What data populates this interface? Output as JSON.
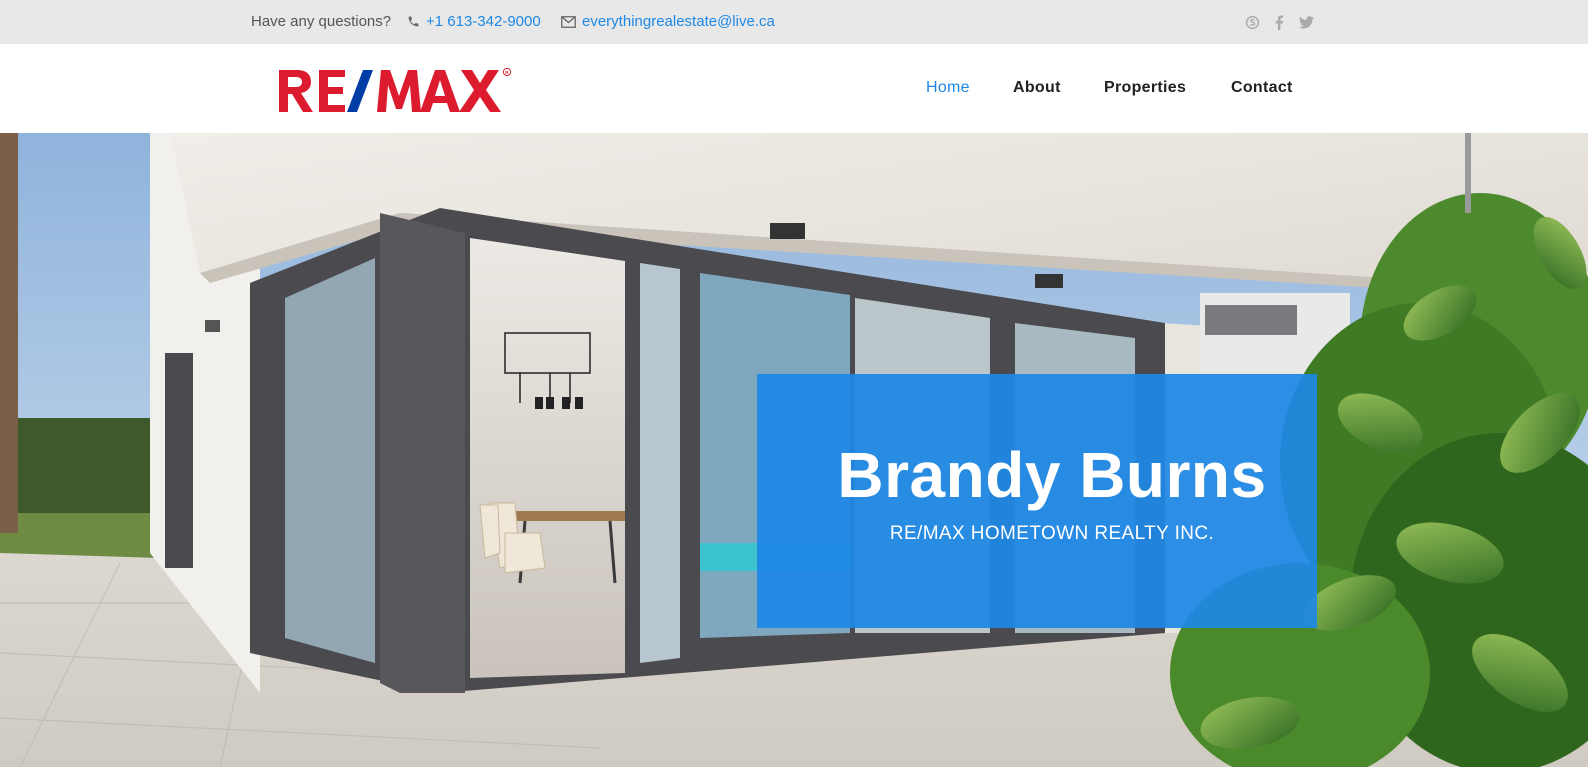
{
  "topbar": {
    "question": "Have any questions?",
    "phone": "+1 613-342-9000",
    "email": "everythingrealestate@live.ca",
    "social_icons": [
      "skype-icon",
      "facebook-icon",
      "twitter-icon"
    ]
  },
  "header": {
    "logo_text": "RE/MAX",
    "nav": [
      {
        "label": "Home",
        "active": true
      },
      {
        "label": "About",
        "active": false
      },
      {
        "label": "Properties",
        "active": false
      },
      {
        "label": "Contact",
        "active": false
      }
    ]
  },
  "hero": {
    "name": "Brandy Burns",
    "brokerage": "RE/MAX HOMETOWN REALTY INC."
  },
  "colors": {
    "accent": "#1e88e5",
    "logo_red": "#dc1c2e",
    "logo_blue": "#003da5",
    "topbar_bg": "#e8e8e8"
  }
}
